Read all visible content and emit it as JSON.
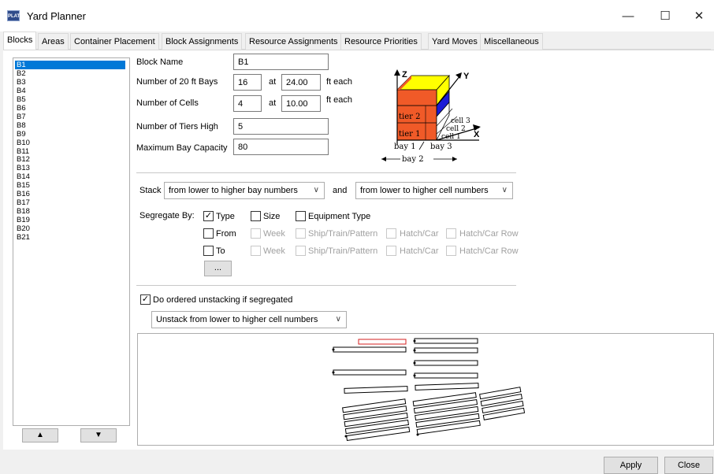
{
  "window": {
    "title": "Yard Planner",
    "icon_text": "PLAT",
    "minimize_glyph": "—",
    "maximize_glyph": "☐",
    "close_glyph": "✕"
  },
  "tabs": [
    {
      "label": "Blocks",
      "active": true
    },
    {
      "label": "Areas"
    },
    {
      "label": "Container Placement"
    },
    {
      "label": "Block Assignments"
    },
    {
      "label": "Resource Assignments"
    },
    {
      "label": "Resource Priorities"
    },
    {
      "label": "Yard Moves"
    },
    {
      "label": "Miscellaneous"
    }
  ],
  "blocks": [
    "B1",
    "B2",
    "B3",
    "B4",
    "B5",
    "B6",
    "B7",
    "B8",
    "B9",
    "B10",
    "B11",
    "B12",
    "B13",
    "B14",
    "B15",
    "B16",
    "B17",
    "B18",
    "B19",
    "B20",
    "B21"
  ],
  "selected_block": "B1",
  "list_nav": {
    "up": "▲",
    "down": "▼"
  },
  "form": {
    "block_name_label": "Block Name",
    "block_name": "B1",
    "bays_label": "Number of 20 ft Bays",
    "bays": "16",
    "at1": "at",
    "bay_length": "24.00",
    "ft_each_1": "ft each",
    "cells_label": "Number of Cells",
    "cells": "4",
    "at2": "at",
    "cell_width": "10.00",
    "ft_each_2": "ft each",
    "tiers_label": "Number of Tiers High",
    "tiers": "5",
    "capacity_label": "Maximum Bay Capacity",
    "capacity": "80"
  },
  "diagram": {
    "axis_z": "Z",
    "axis_y": "Y",
    "axis_x": "X",
    "tier2": "tier 2",
    "tier1": "tier 1",
    "cell3": "cell 3",
    "cell2": "cell 2",
    "cell1": "cell 1",
    "bay1": "bay 1",
    "bay3": "bay 3",
    "bay2": "bay 2",
    "colors": {
      "tier": "#f05a28",
      "top": "#ffff00",
      "blue": "#1c1cd6"
    }
  },
  "stack": {
    "label": "Stack",
    "bay_order": "from lower to higher bay numbers",
    "and": "and",
    "cell_order": "from lower to higher cell numbers"
  },
  "segregate": {
    "label": "Segregate By:",
    "row1": [
      {
        "label": "Type",
        "checked": true,
        "enabled": true
      },
      {
        "label": "Size",
        "checked": false,
        "enabled": true
      },
      {
        "label": "Equipment Type",
        "checked": false,
        "enabled": true
      }
    ],
    "row2": [
      {
        "label": "From",
        "checked": false,
        "enabled": true
      },
      {
        "label": "Week",
        "enabled": false
      },
      {
        "label": "Ship/Train/Pattern",
        "enabled": false
      },
      {
        "label": "Hatch/Car",
        "enabled": false
      },
      {
        "label": "Hatch/Car Row",
        "enabled": false
      }
    ],
    "row3": [
      {
        "label": "To",
        "checked": false,
        "enabled": true
      },
      {
        "label": "Week",
        "enabled": false
      },
      {
        "label": "Ship/Train/Pattern",
        "enabled": false
      },
      {
        "label": "Hatch/Car",
        "enabled": false
      },
      {
        "label": "Hatch/Car Row",
        "enabled": false
      }
    ],
    "more_button": "..."
  },
  "unstacking": {
    "checkbox_label": "Do ordered unstacking if segregated",
    "checked": true,
    "order": "Unstack from lower to higher cell numbers"
  },
  "buttons": {
    "apply": "Apply",
    "close": "Close"
  },
  "check_glyph": "✓",
  "combo_arrow": "∨"
}
